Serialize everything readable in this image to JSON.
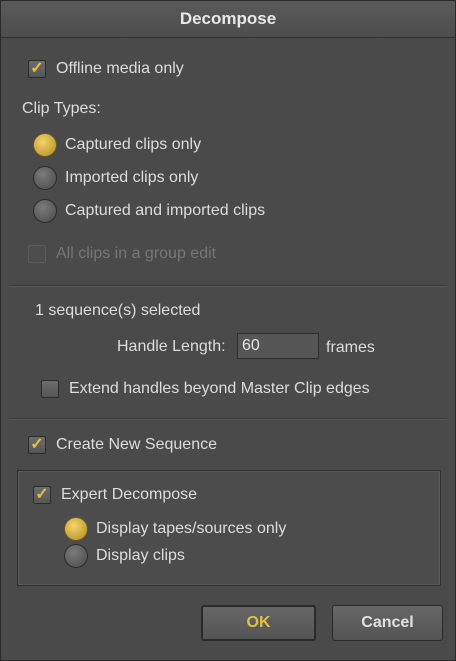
{
  "title": "Decompose",
  "offline_media_only": {
    "label": "Offline media only",
    "checked": true
  },
  "clip_types": {
    "heading": "Clip Types:",
    "options": [
      {
        "label": "Captured clips only",
        "selected": true
      },
      {
        "label": "Imported clips only",
        "selected": false
      },
      {
        "label": "Captured and imported clips",
        "selected": false
      }
    ]
  },
  "all_clips_group_edit": {
    "label": "All clips in a group edit",
    "checked": false,
    "enabled": false
  },
  "sequence_status": "1 sequence(s) selected",
  "handle": {
    "label": "Handle Length:",
    "value": "60",
    "unit": "frames"
  },
  "extend_handles": {
    "label": "Extend handles beyond Master Clip edges",
    "checked": false
  },
  "create_new_sequence": {
    "label": "Create New Sequence",
    "checked": true
  },
  "expert": {
    "label": "Expert Decompose",
    "checked": true,
    "options": [
      {
        "label": "Display tapes/sources only",
        "selected": true
      },
      {
        "label": "Display clips",
        "selected": false
      }
    ]
  },
  "buttons": {
    "ok": "OK",
    "cancel": "Cancel"
  },
  "check_glyph": "✓",
  "accent_color": "#e2c044"
}
